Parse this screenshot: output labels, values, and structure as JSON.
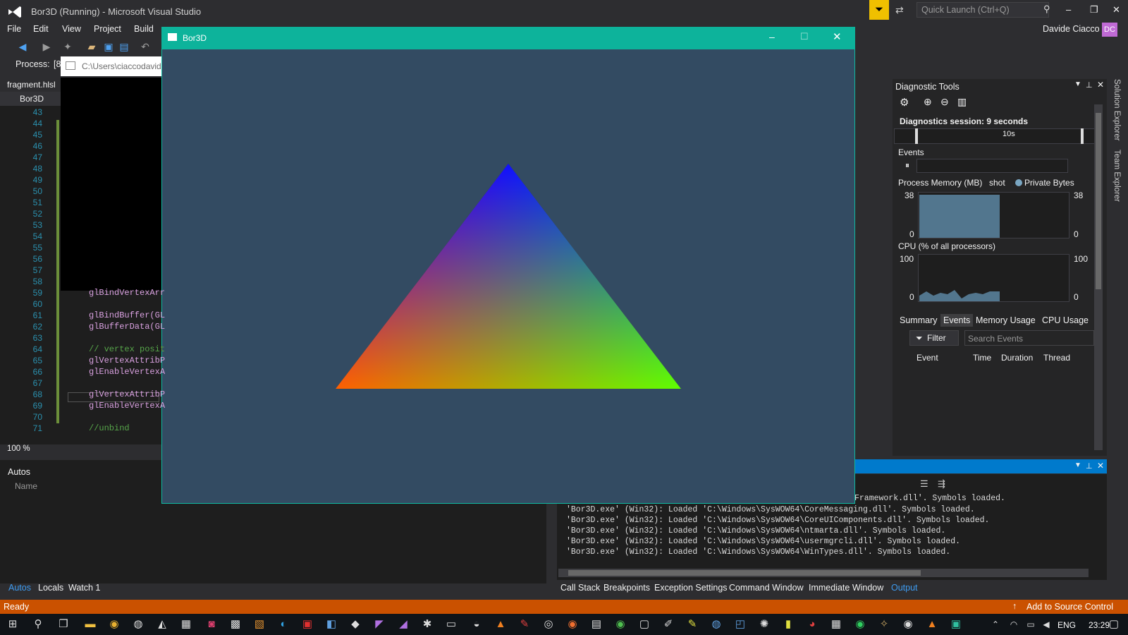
{
  "vs": {
    "title": "Bor3D (Running) - Microsoft Visual Studio",
    "quick_launch_placeholder": "Quick Launch (Ctrl+Q)",
    "user": "Davide Ciacco",
    "user_initials": "DC",
    "menu": [
      "File",
      "Edit",
      "View",
      "Project",
      "Build"
    ],
    "process_label": "Process:",
    "process_value": "[8",
    "file_tab": "fragment.hlsl",
    "project_dropdown": "Bor3D",
    "zoom": "100 %",
    "line_numbers": [
      "43",
      "44",
      "45",
      "46",
      "47",
      "48",
      "49",
      "50",
      "51",
      "52",
      "53",
      "54",
      "55",
      "56",
      "57",
      "58",
      "59",
      "60",
      "61",
      "62",
      "63",
      "64",
      "65",
      "66",
      "67",
      "68",
      "69",
      "70",
      "71"
    ],
    "code_lines": [
      {
        "line": "59",
        "text": "glBindVertexArr"
      },
      {
        "line": "61",
        "text": "glBindBuffer(GL"
      },
      {
        "line": "62",
        "text": "glBufferData(GL"
      },
      {
        "line": "64",
        "text": "// vertex posit"
      },
      {
        "line": "65",
        "text": "glVertexAttribP"
      },
      {
        "line": "66",
        "text": "glEnableVertexA"
      },
      {
        "line": "68",
        "text": "glVertexAttribP"
      },
      {
        "line": "69",
        "text": "glEnableVertexA"
      },
      {
        "line": "71",
        "text": "//unbind"
      }
    ],
    "console_title": "C:\\Users\\ciaccodavid"
  },
  "app_window": {
    "title": "Bor3D",
    "bg_color": "#334b62",
    "titlebar_color": "#0db39b",
    "triangle_colors": {
      "top": "#0000ff",
      "left": "#ff0000",
      "right": "#00ff00"
    }
  },
  "diagnostics": {
    "title": "Diagnostic Tools",
    "session": "Diagnostics session: 9 seconds",
    "timeline_label": "10s",
    "events_label": "Events",
    "memory_label": "Process Memory (MB)",
    "memory_snapshot": "shot",
    "memory_legend": "Private Bytes",
    "memory_max": "38",
    "memory_min": "0",
    "cpu_label": "CPU (% of all processors)",
    "cpu_max": "100",
    "cpu_min": "0",
    "tabs": [
      "Summary",
      "Events",
      "Memory Usage",
      "CPU Usage"
    ],
    "active_tab": "Events",
    "filter_label": "Filter",
    "search_placeholder": "Search Events",
    "columns": [
      "Event",
      "Time",
      "Duration",
      "Thread"
    ],
    "side_tabs": [
      "Solution Explorer",
      "Team Explorer"
    ]
  },
  "output": {
    "first_partial": "Framework.dll'. Symbols loaded.",
    "lines": [
      "'Bor3D.exe' (Win32): Loaded 'C:\\Windows\\SysWOW64\\CoreMessaging.dll'. Symbols loaded.",
      "'Bor3D.exe' (Win32): Loaded 'C:\\Windows\\SysWOW64\\CoreUIComponents.dll'. Symbols loaded.",
      "'Bor3D.exe' (Win32): Loaded 'C:\\Windows\\SysWOW64\\ntmarta.dll'. Symbols loaded.",
      "'Bor3D.exe' (Win32): Loaded 'C:\\Windows\\SysWOW64\\usermgrcli.dll'. Symbols loaded.",
      "'Bor3D.exe' (Win32): Loaded 'C:\\Windows\\SysWOW64\\WinTypes.dll'. Symbols loaded."
    ]
  },
  "autos": {
    "title": "Autos",
    "column": "Name",
    "tabs": [
      "Autos",
      "Locals",
      "Watch 1"
    ]
  },
  "bottom_tabs": [
    "Call Stack",
    "Breakpoints",
    "Exception Settings",
    "Command Window",
    "Immediate Window",
    "Output"
  ],
  "status": {
    "text": "Ready",
    "source_control": "Add to Source Control"
  },
  "taskbar": {
    "lang": "ENG",
    "time": "23:29"
  }
}
